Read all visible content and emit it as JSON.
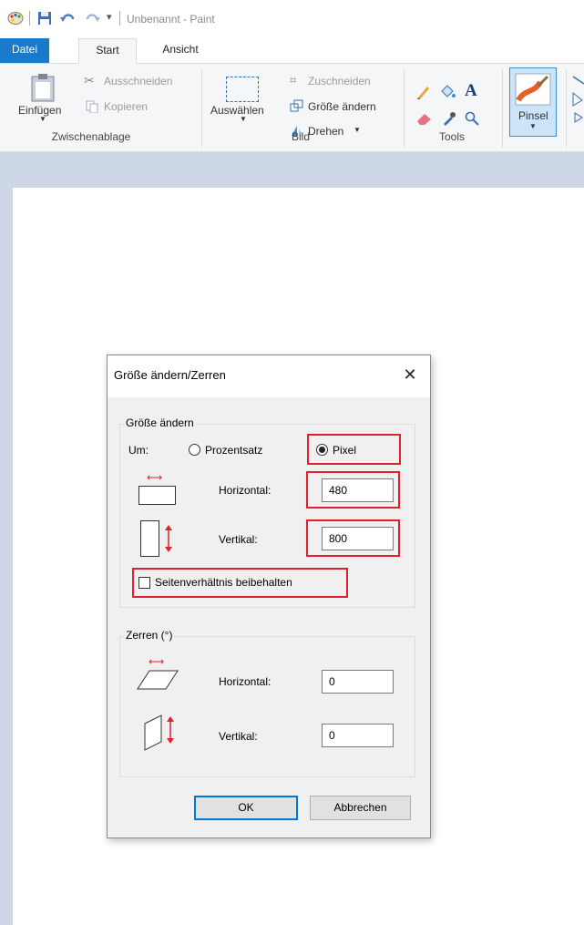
{
  "window": {
    "title": "Unbenannt - Paint"
  },
  "tabs": {
    "file": "Datei",
    "start": "Start",
    "view": "Ansicht"
  },
  "ribbon": {
    "clipboard": {
      "paste": "Einfügen",
      "cut": "Ausschneiden",
      "copy": "Kopieren",
      "group": "Zwischenablage"
    },
    "image": {
      "select": "Auswählen",
      "crop": "Zuschneiden",
      "resize": "Größe ändern",
      "rotate": "Drehen",
      "group": "Bild"
    },
    "tools": {
      "group": "Tools"
    },
    "brushes": {
      "label": "Pinsel"
    }
  },
  "dialog": {
    "title": "Größe ändern/Zerren",
    "resize": {
      "legend": "Größe ändern",
      "by_label": "Um:",
      "percent_label": "Prozentsatz",
      "pixel_label": "Pixel",
      "selected_unit": "Pixel",
      "horizontal_label": "Horizontal:",
      "horizontal_value": "480",
      "vertical_label": "Vertikal:",
      "vertical_value": "800",
      "aspect_label": "Seitenverhältnis beibehalten",
      "aspect_checked": false
    },
    "skew": {
      "legend": "Zerren (°)",
      "horizontal_label": "Horizontal:",
      "horizontal_value": "0",
      "vertical_label": "Vertikal:",
      "vertical_value": "0"
    },
    "ok": "OK",
    "cancel": "Abbrechen"
  },
  "colors": {
    "highlight": "#e0202a",
    "accent": "#1979ca"
  }
}
